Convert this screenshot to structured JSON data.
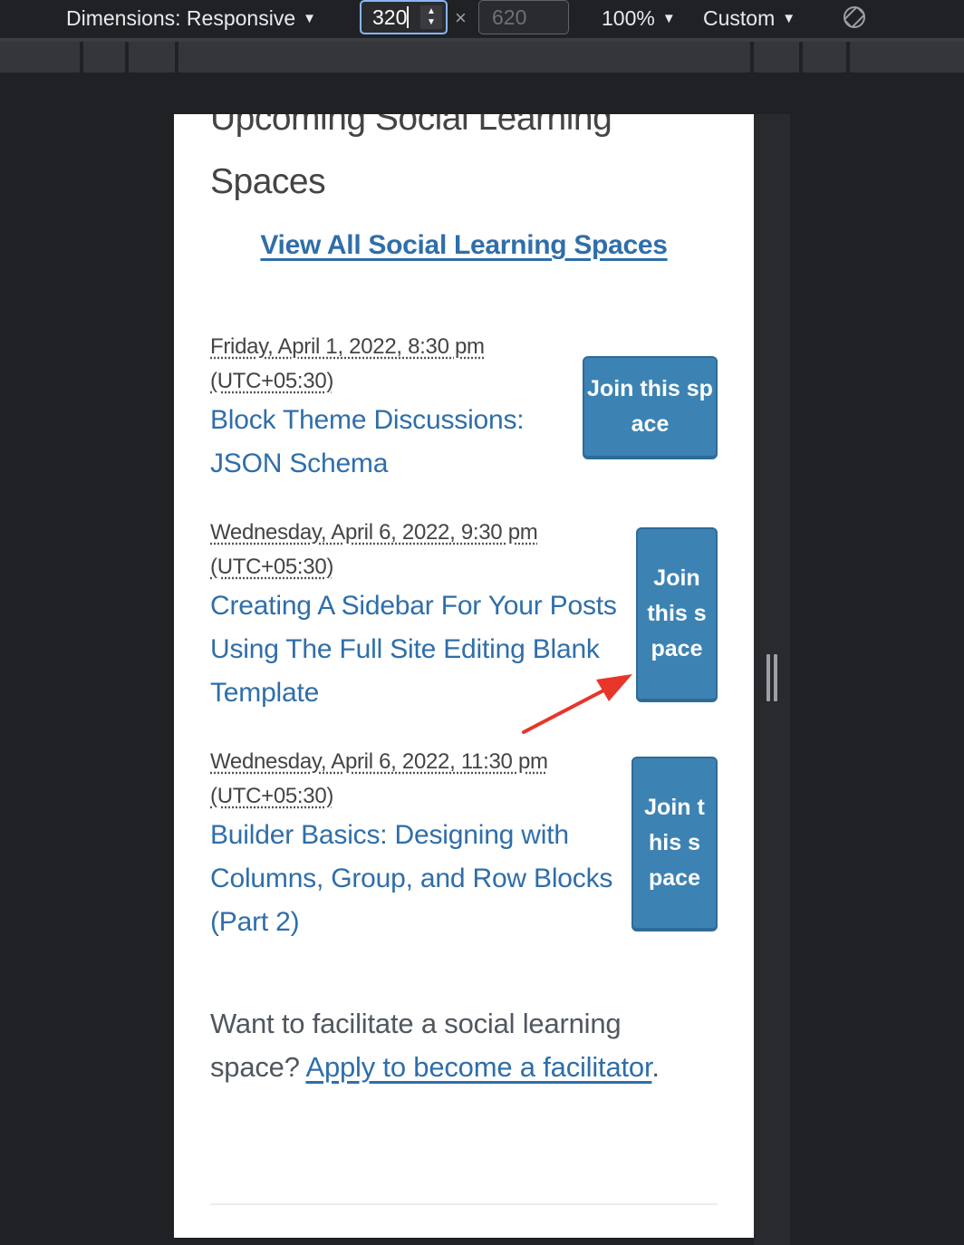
{
  "devtools": {
    "dimensions_label": "Dimensions: Responsive",
    "width_value": "320",
    "times_symbol": "×",
    "height_placeholder": "620",
    "zoom_value": "100%",
    "throttle_value": "Custom",
    "caret": "▼",
    "rotate_icon": "rotate-icon"
  },
  "page": {
    "heading": "Upcoming Social Learning Spaces",
    "view_all_link": "View All Social Learning Spaces",
    "events": [
      {
        "date": "Friday, April 1, 2022, 8:30 pm",
        "timezone": "(UTC+05:30)",
        "title": "Block Theme Discussions: JSON Schema",
        "join_label": "Join this space"
      },
      {
        "date": "Wednesday, April 6, 2022, 9:30 pm",
        "timezone": "(UTC+05:30)",
        "title": "Creating A Sidebar For Your Posts Using The Full Site Editing Blank Template",
        "join_label": "Join this space"
      },
      {
        "date": "Wednesday, April 6, 2022, 11:30 pm",
        "timezone": "(UTC+05:30)",
        "title": "Builder Basics: Designing with Columns, Group, and Row Blocks (Part 2)",
        "join_label": "Join this space"
      }
    ],
    "facilitate_text": "Want to facilitate a social learning space?",
    "facilitate_link": "Apply to become a facilitator",
    "facilitate_end": "."
  },
  "colors": {
    "link": "#2f6ea9",
    "button": "#3c83b4",
    "annotation_arrow": "#e8352a",
    "devtools_bg": "#202124"
  }
}
